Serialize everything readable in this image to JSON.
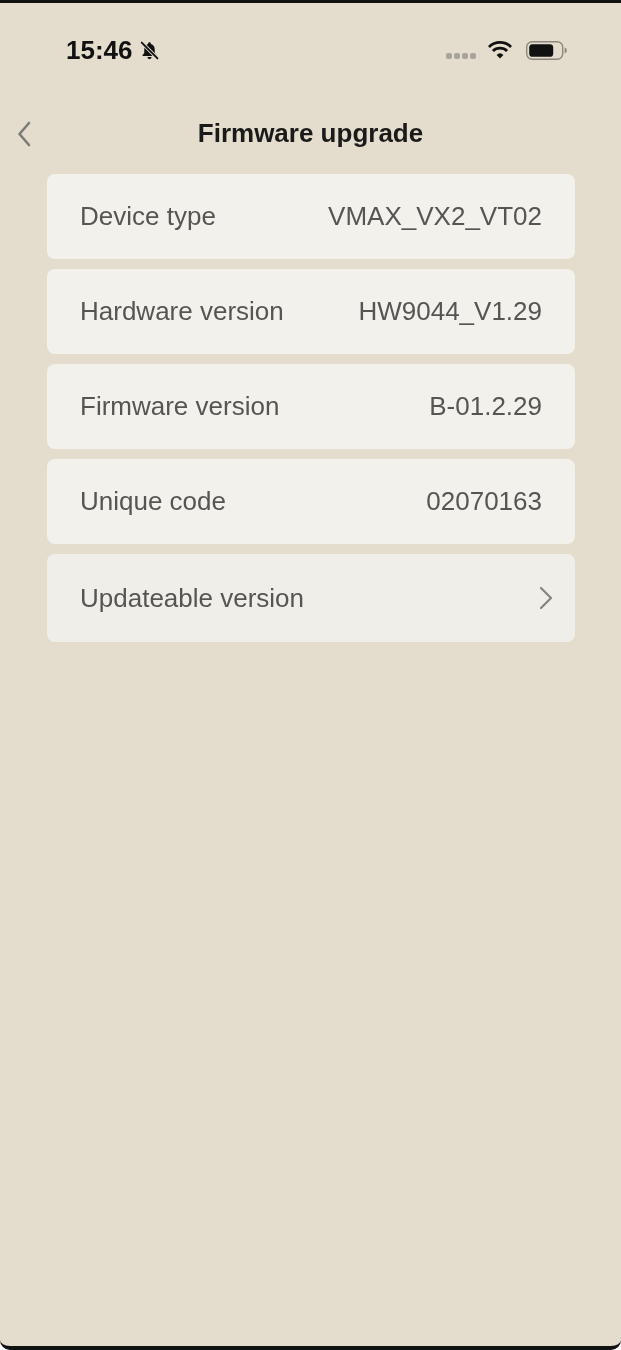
{
  "status_bar": {
    "time": "15:46",
    "silent": true
  },
  "nav": {
    "title": "Firmware upgrade"
  },
  "rows": [
    {
      "kind": "info",
      "label": "Device type",
      "value": "VMAX_VX2_VT02"
    },
    {
      "kind": "info",
      "label": "Hardware version",
      "value": "HW9044_V1.29"
    },
    {
      "kind": "info",
      "label": "Firmware version",
      "value": "B-01.2.29"
    },
    {
      "kind": "info",
      "label": "Unique code",
      "value": "02070163"
    },
    {
      "kind": "link",
      "label": "Updateable version"
    }
  ]
}
